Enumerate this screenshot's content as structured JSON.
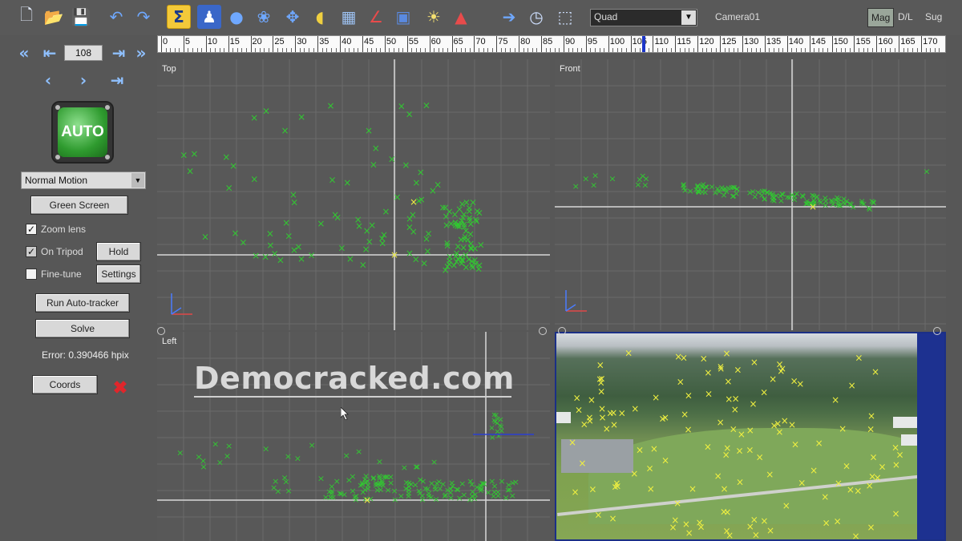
{
  "toolbar": {
    "icons": [
      "new-file-icon",
      "open-folder-icon",
      "save-disk-icon",
      "undo-icon",
      "redo-icon",
      "sigma-icon",
      "tripod-icon",
      "globe-icon",
      "paw-icon",
      "move-icon",
      "mirror-icon",
      "calculator-icon",
      "edit-axis-icon",
      "cube-icon",
      "lightbulb-icon",
      "mountain-icon",
      "forward-arrow-icon",
      "zoom-clock-icon",
      "fit-view-icon"
    ],
    "view_select": "Quad",
    "camera": "Camera01",
    "mode_buttons": [
      "Mag",
      "D/L",
      "Sug"
    ]
  },
  "timeline": {
    "labels": [
      "0",
      "5",
      "10",
      "15",
      "20",
      "25",
      "30",
      "35",
      "40",
      "45",
      "50",
      "55",
      "60",
      "65",
      "70",
      "75",
      "80",
      "85",
      "90",
      "95",
      "100",
      "105",
      "110",
      "115",
      "120",
      "125",
      "130",
      "135",
      "140",
      "145",
      "150",
      "155",
      "160",
      "165",
      "170"
    ],
    "current_frame": 108,
    "max_frame": 175
  },
  "left_panel": {
    "frame_value": "108",
    "auto_label": "AUTO",
    "motion_select": "Normal Motion",
    "green_screen": "Green Screen",
    "zoom_lens": {
      "label": "Zoom lens",
      "checked": true
    },
    "on_tripod": {
      "label": "On Tripod",
      "checked": true
    },
    "fine_tune": {
      "label": "Fine-tune",
      "checked": false
    },
    "hold": "Hold",
    "settings": "Settings",
    "run_autotracker": "Run Auto-tracker",
    "solve": "Solve",
    "error": "Error: 0.390466 hpix",
    "coords": "Coords"
  },
  "viewports": {
    "top": "Top",
    "front": "Front",
    "left": "Left"
  },
  "colors": {
    "tracker": "#32c832",
    "yellow_marker": "#f0f040",
    "timeline_cursor": "#1c36c8"
  },
  "watermark": "Democracked.com"
}
